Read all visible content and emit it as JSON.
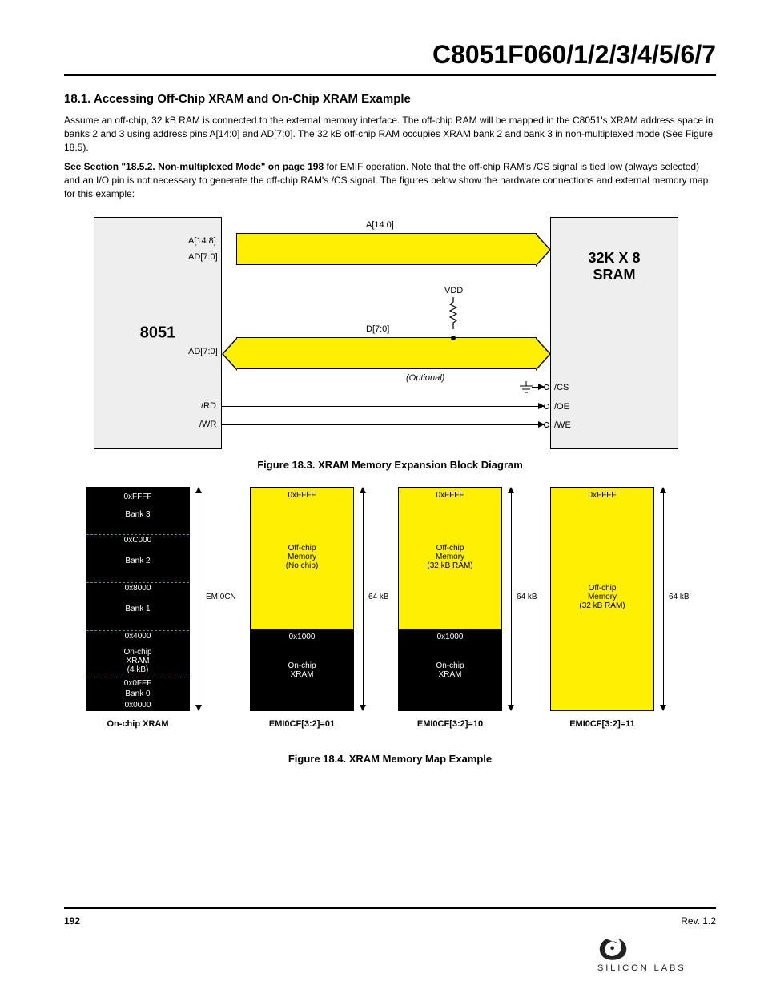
{
  "header": {
    "part": "C8051F060/1/2/3/4/5/6/7"
  },
  "section": {
    "num": "18.1.",
    "title": "Accessing Off-Chip XRAM and On-Chip XRAM Example",
    "p1": "Assume an off-chip, 32 kB RAM is connected to the external memory interface. The off-chip RAM will be mapped in the C8051's XRAM address space in banks 2 and 3 using address pins A[14:0] and AD[7:0]. The 32 kB off-chip RAM occupies XRAM bank 2 and bank 3 in non-multiplexed mode (See Figure 18.5).",
    "p2_a": "See Section \"18.5.2. Non-multiplexed Mode\" on page 198 ",
    "p2_b": "for EMIF operation. Note that the off-chip RAM's /CS signal is tied low (always selected) and an I/O pin is not necessary to generate the off-chip RAM's /CS signal. The figures below show the hardware connections and external memory map for this example:"
  },
  "fig18_3": {
    "block8051": "8051",
    "blockram": "32K X 8\nSRAM",
    "bus_addr": "A[14:0]",
    "bus_addr_left": "A[14:8]",
    "bus_addr_left2": "AD[7:0]",
    "bus_data": "D[7:0]",
    "pullup": "VDD",
    "rd": "/RD",
    "wr": "/WR",
    "cs": "/CS",
    "oe": "/OE",
    "we": "/WE",
    "opt": "(Optional)",
    "caption": "Figure 18.3. XRAM Memory Expansion Block Diagram"
  },
  "fig18_4": {
    "pane1": {
      "title": "On-chip XRAM",
      "bank3": "Bank 3",
      "bank2": "Bank 2",
      "bank1": "Bank 1",
      "bank0": "Bank 0",
      "top_byte": "0xFFFF",
      "sep3": "0xC000",
      "sep2": "0x8000",
      "sep1": "0x4000",
      "head": "On-chip\nXRAM\n(4 kB)",
      "a_onchip": "0x0FFF",
      "a_0": "0x0000",
      "br": "EMI0CN"
    },
    "pane2": {
      "title": "EMI0CF[3:2]=01",
      "top_byte": "0xFFFF",
      "offchip": "Off-chip\nMemory\n(No chip)",
      "gap_addr": "0x1000",
      "onchip": "On-chip\nXRAM",
      "br": "64 kB"
    },
    "pane3": {
      "title": "EMI0CF[3:2]=10",
      "top_byte": "0xFFFF",
      "offchip": "Off-chip\nMemory\n(32 kB RAM)",
      "gap_addr": "0x1000",
      "onchip": "On-chip\nXRAM",
      "br": "64 kB"
    },
    "pane4": {
      "title": "EMI0CF[3:2]=11",
      "top_byte": "0xFFFF",
      "offchip": "Off-chip\nMemory\n(32 kB RAM)",
      "br": "64 kB"
    },
    "caption": "Figure 18.4. XRAM Memory Map Example"
  },
  "footer": {
    "pg": "192",
    "rev": "Rev. 1.2",
    "logo": "SILICON LABS"
  }
}
